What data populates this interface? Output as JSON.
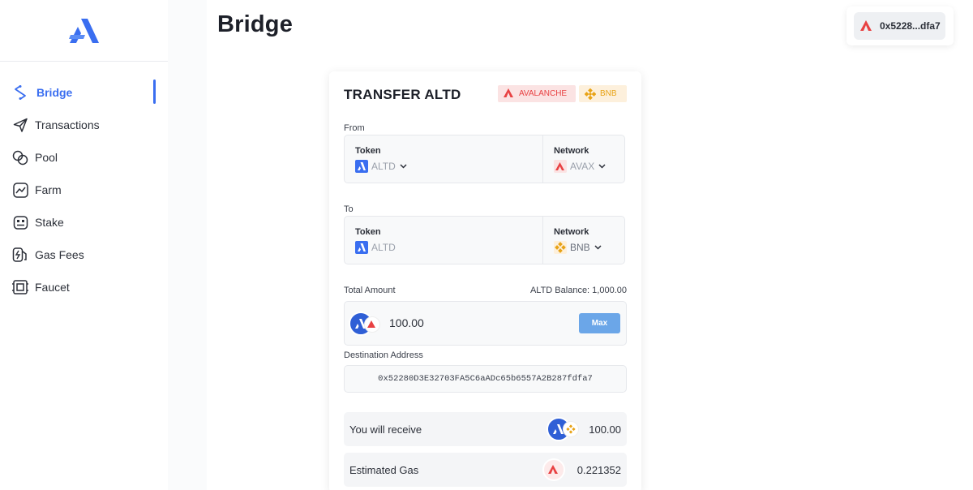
{
  "app": {
    "page_title": "Bridge"
  },
  "wallet": {
    "address": "0x5228...dfa7",
    "icon": "avalanche-icon"
  },
  "sidebar": {
    "items": [
      {
        "label": "Bridge",
        "icon": "bridge-icon",
        "active": true
      },
      {
        "label": "Transactions",
        "icon": "send-icon"
      },
      {
        "label": "Pool",
        "icon": "pool-icon"
      },
      {
        "label": "Farm",
        "icon": "chart-icon"
      },
      {
        "label": "Stake",
        "icon": "stake-icon"
      },
      {
        "label": "Gas Fees",
        "icon": "gas-icon"
      },
      {
        "label": "Faucet",
        "icon": "faucet-icon"
      }
    ]
  },
  "card": {
    "title": "TRANSFER ALTD",
    "chips": {
      "avalanche": "AVALANCHE",
      "bnb": "BNB"
    },
    "from": {
      "label": "From",
      "token_label": "Token",
      "token_value": "ALTD",
      "network_label": "Network",
      "network_value": "AVAX"
    },
    "to": {
      "label": "To",
      "token_label": "Token",
      "token_value": "ALTD",
      "network_label": "Network",
      "network_value": "BNB"
    },
    "amount": {
      "label": "Total Amount",
      "balance": "ALTD Balance: 1,000.00",
      "value": "100.00",
      "max_label": "Max"
    },
    "destination": {
      "label": "Destination Address",
      "value": "0x52280D3E32703FA5C6aADc65b6557A2B287fdfa7"
    },
    "receive": {
      "label": "You will receive",
      "value": "100.00"
    },
    "gas": {
      "label": "Estimated Gas",
      "value": "0.221352"
    }
  },
  "colors": {
    "accent": "#3a6ef0",
    "avax": "#e84142",
    "bnb": "#e8a317",
    "max_button": "#6ba6e8"
  }
}
